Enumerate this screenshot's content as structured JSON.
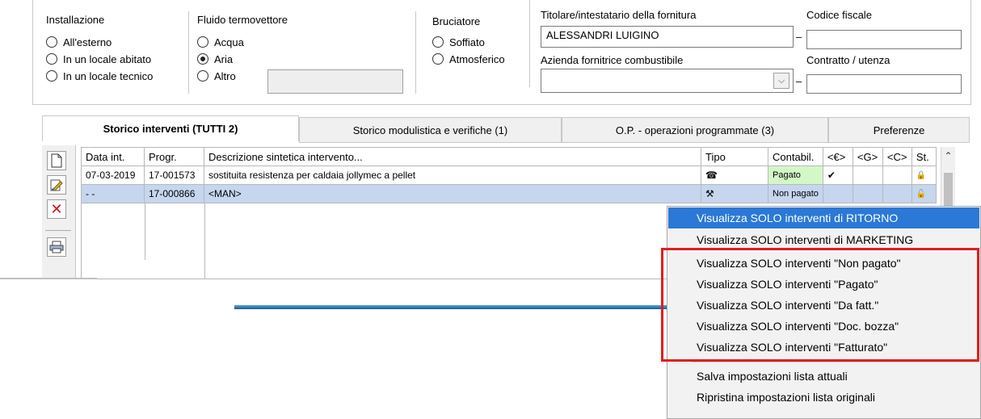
{
  "installazione": {
    "title": "Installazione",
    "options": [
      "All'esterno",
      "In un locale abitato",
      "In un locale tecnico"
    ]
  },
  "fluido": {
    "title": "Fluido termovettore",
    "options": [
      "Acqua",
      "Aria",
      "Altro"
    ],
    "selected": "Aria",
    "altro_value": ""
  },
  "bruciatore": {
    "title": "Bruciatore",
    "options": [
      "Soffiato",
      "Atmosferico"
    ]
  },
  "titolare": {
    "label": "Titolare/intestatario della fornitura",
    "value": "ALESSANDRI LUIGINO"
  },
  "codice_fiscale": {
    "label": "Codice fiscale",
    "value": "",
    "dash": "–"
  },
  "azienda": {
    "label": "Azienda fornitrice combustibile",
    "value": ""
  },
  "contratto": {
    "label": "Contratto / utenza",
    "value": "",
    "dash": "–"
  },
  "tabs": [
    {
      "label": "Storico interventi  (TUTTI 2)",
      "active": true
    },
    {
      "label": "Storico modulistica e verifiche  (1)",
      "active": false
    },
    {
      "label": "O.P. - operazioni programmate  (3)",
      "active": false
    },
    {
      "label": "Preferenze",
      "active": false
    }
  ],
  "grid": {
    "headers": [
      "Data int.",
      "Progr.",
      "Descrizione sintetica intervento...",
      "Tipo",
      "Contabil.",
      "<€>",
      "<G>",
      "<C>",
      "St."
    ],
    "rows": [
      {
        "data": "07-03-2019",
        "progr": "17-001573",
        "descr": "sostituita resistenza per caldaia jollymec a pellet",
        "tipo": "☎",
        "contabil": "Pagato",
        "euro": "✔",
        "g": "",
        "c": "",
        "st": "🔒"
      },
      {
        "data": "- -",
        "progr": "17-000866",
        "descr": "<MAN>",
        "tipo": "⚒",
        "contabil": "Non pagato",
        "euro": "",
        "g": "",
        "c": "",
        "st": "🔓"
      }
    ]
  },
  "menu": {
    "items": [
      "Visualizza SOLO interventi di RITORNO",
      "Visualizza SOLO interventi di MARKETING",
      "Visualizza SOLO interventi \"Non pagato\"",
      "Visualizza SOLO interventi \"Pagato\"",
      "Visualizza SOLO interventi \"Da fatt.\"",
      "Visualizza SOLO interventi \"Doc. bozza\"",
      "Visualizza SOLO interventi \"Fatturato\"",
      "Salva impostazioni lista attuali",
      "Ripristina impostazioni lista originali"
    ],
    "highlighted": 0,
    "highlight_color": "#2b78d6",
    "box_color": "#e01e1e"
  },
  "icons": {
    "new": "new-document-icon",
    "edit": "edit-document-icon",
    "delete": "delete-x-icon",
    "print": "printer-icon",
    "scroll_up": "chevron-up-icon",
    "dropdown": "chevron-down-icon"
  }
}
